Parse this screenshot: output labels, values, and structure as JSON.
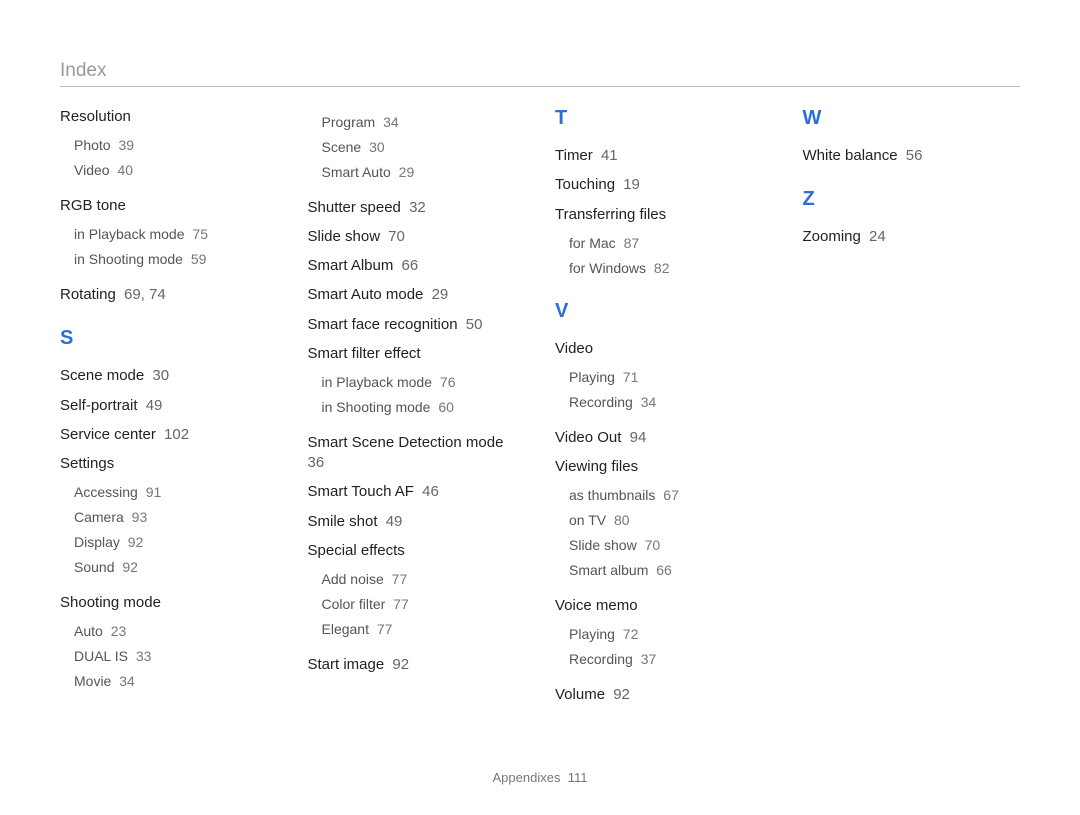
{
  "page_title": "Index",
  "footer": {
    "section": "Appendixes",
    "page": "111"
  },
  "columns": [
    [
      {
        "type": "block",
        "title": "Resolution",
        "subs": [
          {
            "label": "Photo",
            "page": "39"
          },
          {
            "label": "Video",
            "page": "40"
          }
        ]
      },
      {
        "type": "block",
        "title": "RGB tone",
        "subs": [
          {
            "label": "in Playback mode",
            "page": "75"
          },
          {
            "label": "in Shooting mode",
            "page": "59"
          }
        ]
      },
      {
        "type": "entry",
        "label": "Rotating",
        "page": "69, 74"
      },
      {
        "type": "letter",
        "label": "S"
      },
      {
        "type": "entry",
        "label": "Scene mode",
        "page": "30"
      },
      {
        "type": "entry",
        "label": "Self-portrait",
        "page": "49"
      },
      {
        "type": "entry",
        "label": "Service center",
        "page": "102"
      },
      {
        "type": "block",
        "title": "Settings",
        "subs": [
          {
            "label": "Accessing",
            "page": "91"
          },
          {
            "label": "Camera",
            "page": "93"
          },
          {
            "label": "Display",
            "page": "92"
          },
          {
            "label": "Sound",
            "page": "92"
          }
        ]
      },
      {
        "type": "block",
        "title": "Shooting mode",
        "subs": [
          {
            "label": "Auto",
            "page": "23"
          },
          {
            "label": "DUAL IS",
            "page": "33"
          },
          {
            "label": "Movie",
            "page": "34"
          }
        ]
      }
    ],
    [
      {
        "type": "subgroup",
        "subs": [
          {
            "label": "Program",
            "page": "34"
          },
          {
            "label": "Scene",
            "page": "30"
          },
          {
            "label": "Smart Auto",
            "page": "29"
          }
        ]
      },
      {
        "type": "entry",
        "label": "Shutter speed",
        "page": "32"
      },
      {
        "type": "entry",
        "label": "Slide show",
        "page": "70"
      },
      {
        "type": "entry",
        "label": "Smart Album",
        "page": "66"
      },
      {
        "type": "entry",
        "label": "Smart Auto mode",
        "page": "29"
      },
      {
        "type": "entry",
        "label": "Smart face recognition",
        "page": "50"
      },
      {
        "type": "block",
        "title": "Smart filter effect",
        "subs": [
          {
            "label": "in Playback mode",
            "page": "76"
          },
          {
            "label": "in Shooting mode",
            "page": "60"
          }
        ]
      },
      {
        "type": "entry",
        "label": "Smart Scene Detection mode",
        "page": "36"
      },
      {
        "type": "entry",
        "label": "Smart Touch AF",
        "page": "46"
      },
      {
        "type": "entry",
        "label": "Smile shot",
        "page": "49"
      },
      {
        "type": "block",
        "title": "Special effects",
        "subs": [
          {
            "label": "Add noise",
            "page": "77"
          },
          {
            "label": "Color filter",
            "page": "77"
          },
          {
            "label": "Elegant",
            "page": "77"
          }
        ]
      },
      {
        "type": "entry",
        "label": "Start image",
        "page": "92"
      }
    ],
    [
      {
        "type": "letter",
        "label": "T",
        "first": true
      },
      {
        "type": "entry",
        "label": "Timer",
        "page": "41"
      },
      {
        "type": "entry",
        "label": "Touching",
        "page": "19"
      },
      {
        "type": "block",
        "title": "Transferring files",
        "subs": [
          {
            "label": "for Mac",
            "page": "87"
          },
          {
            "label": "for Windows",
            "page": "82"
          }
        ]
      },
      {
        "type": "letter",
        "label": "V"
      },
      {
        "type": "block",
        "title": "Video",
        "subs": [
          {
            "label": "Playing",
            "page": "71"
          },
          {
            "label": "Recording",
            "page": "34"
          }
        ]
      },
      {
        "type": "entry",
        "label": "Video Out",
        "page": "94"
      },
      {
        "type": "block",
        "title": "Viewing files",
        "subs": [
          {
            "label": "as thumbnails",
            "page": "67"
          },
          {
            "label": "on TV",
            "page": "80"
          },
          {
            "label": "Slide show",
            "page": "70"
          },
          {
            "label": "Smart album",
            "page": "66"
          }
        ]
      },
      {
        "type": "block",
        "title": "Voice memo",
        "subs": [
          {
            "label": "Playing",
            "page": "72"
          },
          {
            "label": "Recording",
            "page": "37"
          }
        ]
      },
      {
        "type": "entry",
        "label": "Volume",
        "page": "92"
      }
    ],
    [
      {
        "type": "letter",
        "label": "W",
        "first": true
      },
      {
        "type": "entry",
        "label": "White balance",
        "page": "56"
      },
      {
        "type": "letter",
        "label": "Z"
      },
      {
        "type": "entry",
        "label": "Zooming",
        "page": "24"
      }
    ]
  ]
}
